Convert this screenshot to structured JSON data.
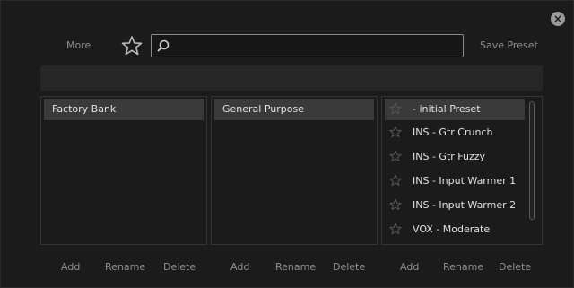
{
  "toolbar": {
    "more_label": "More",
    "search_placeholder": "",
    "save_label": "Save Preset"
  },
  "banks": {
    "items": [
      {
        "label": "Factory Bank",
        "selected": true
      }
    ],
    "footer": {
      "add": "Add",
      "rename": "Rename",
      "delete": "Delete"
    }
  },
  "categories": {
    "items": [
      {
        "label": "General Purpose",
        "selected": true
      }
    ],
    "footer": {
      "add": "Add",
      "rename": "Rename",
      "delete": "Delete"
    }
  },
  "presets": {
    "items": [
      {
        "label": "- initial Preset",
        "selected": true
      },
      {
        "label": "INS - Gtr Crunch"
      },
      {
        "label": "INS - Gtr Fuzzy"
      },
      {
        "label": "INS - Input Warmer 1"
      },
      {
        "label": "INS - Input Warmer 2"
      },
      {
        "label": "VOX - Moderate"
      }
    ],
    "footer": {
      "add": "Add",
      "rename": "Rename",
      "delete": "Delete"
    }
  },
  "colors": {
    "background": "#1b1b1b",
    "selected_row": "#3a3a3a",
    "muted_text": "#8f8f8f"
  }
}
